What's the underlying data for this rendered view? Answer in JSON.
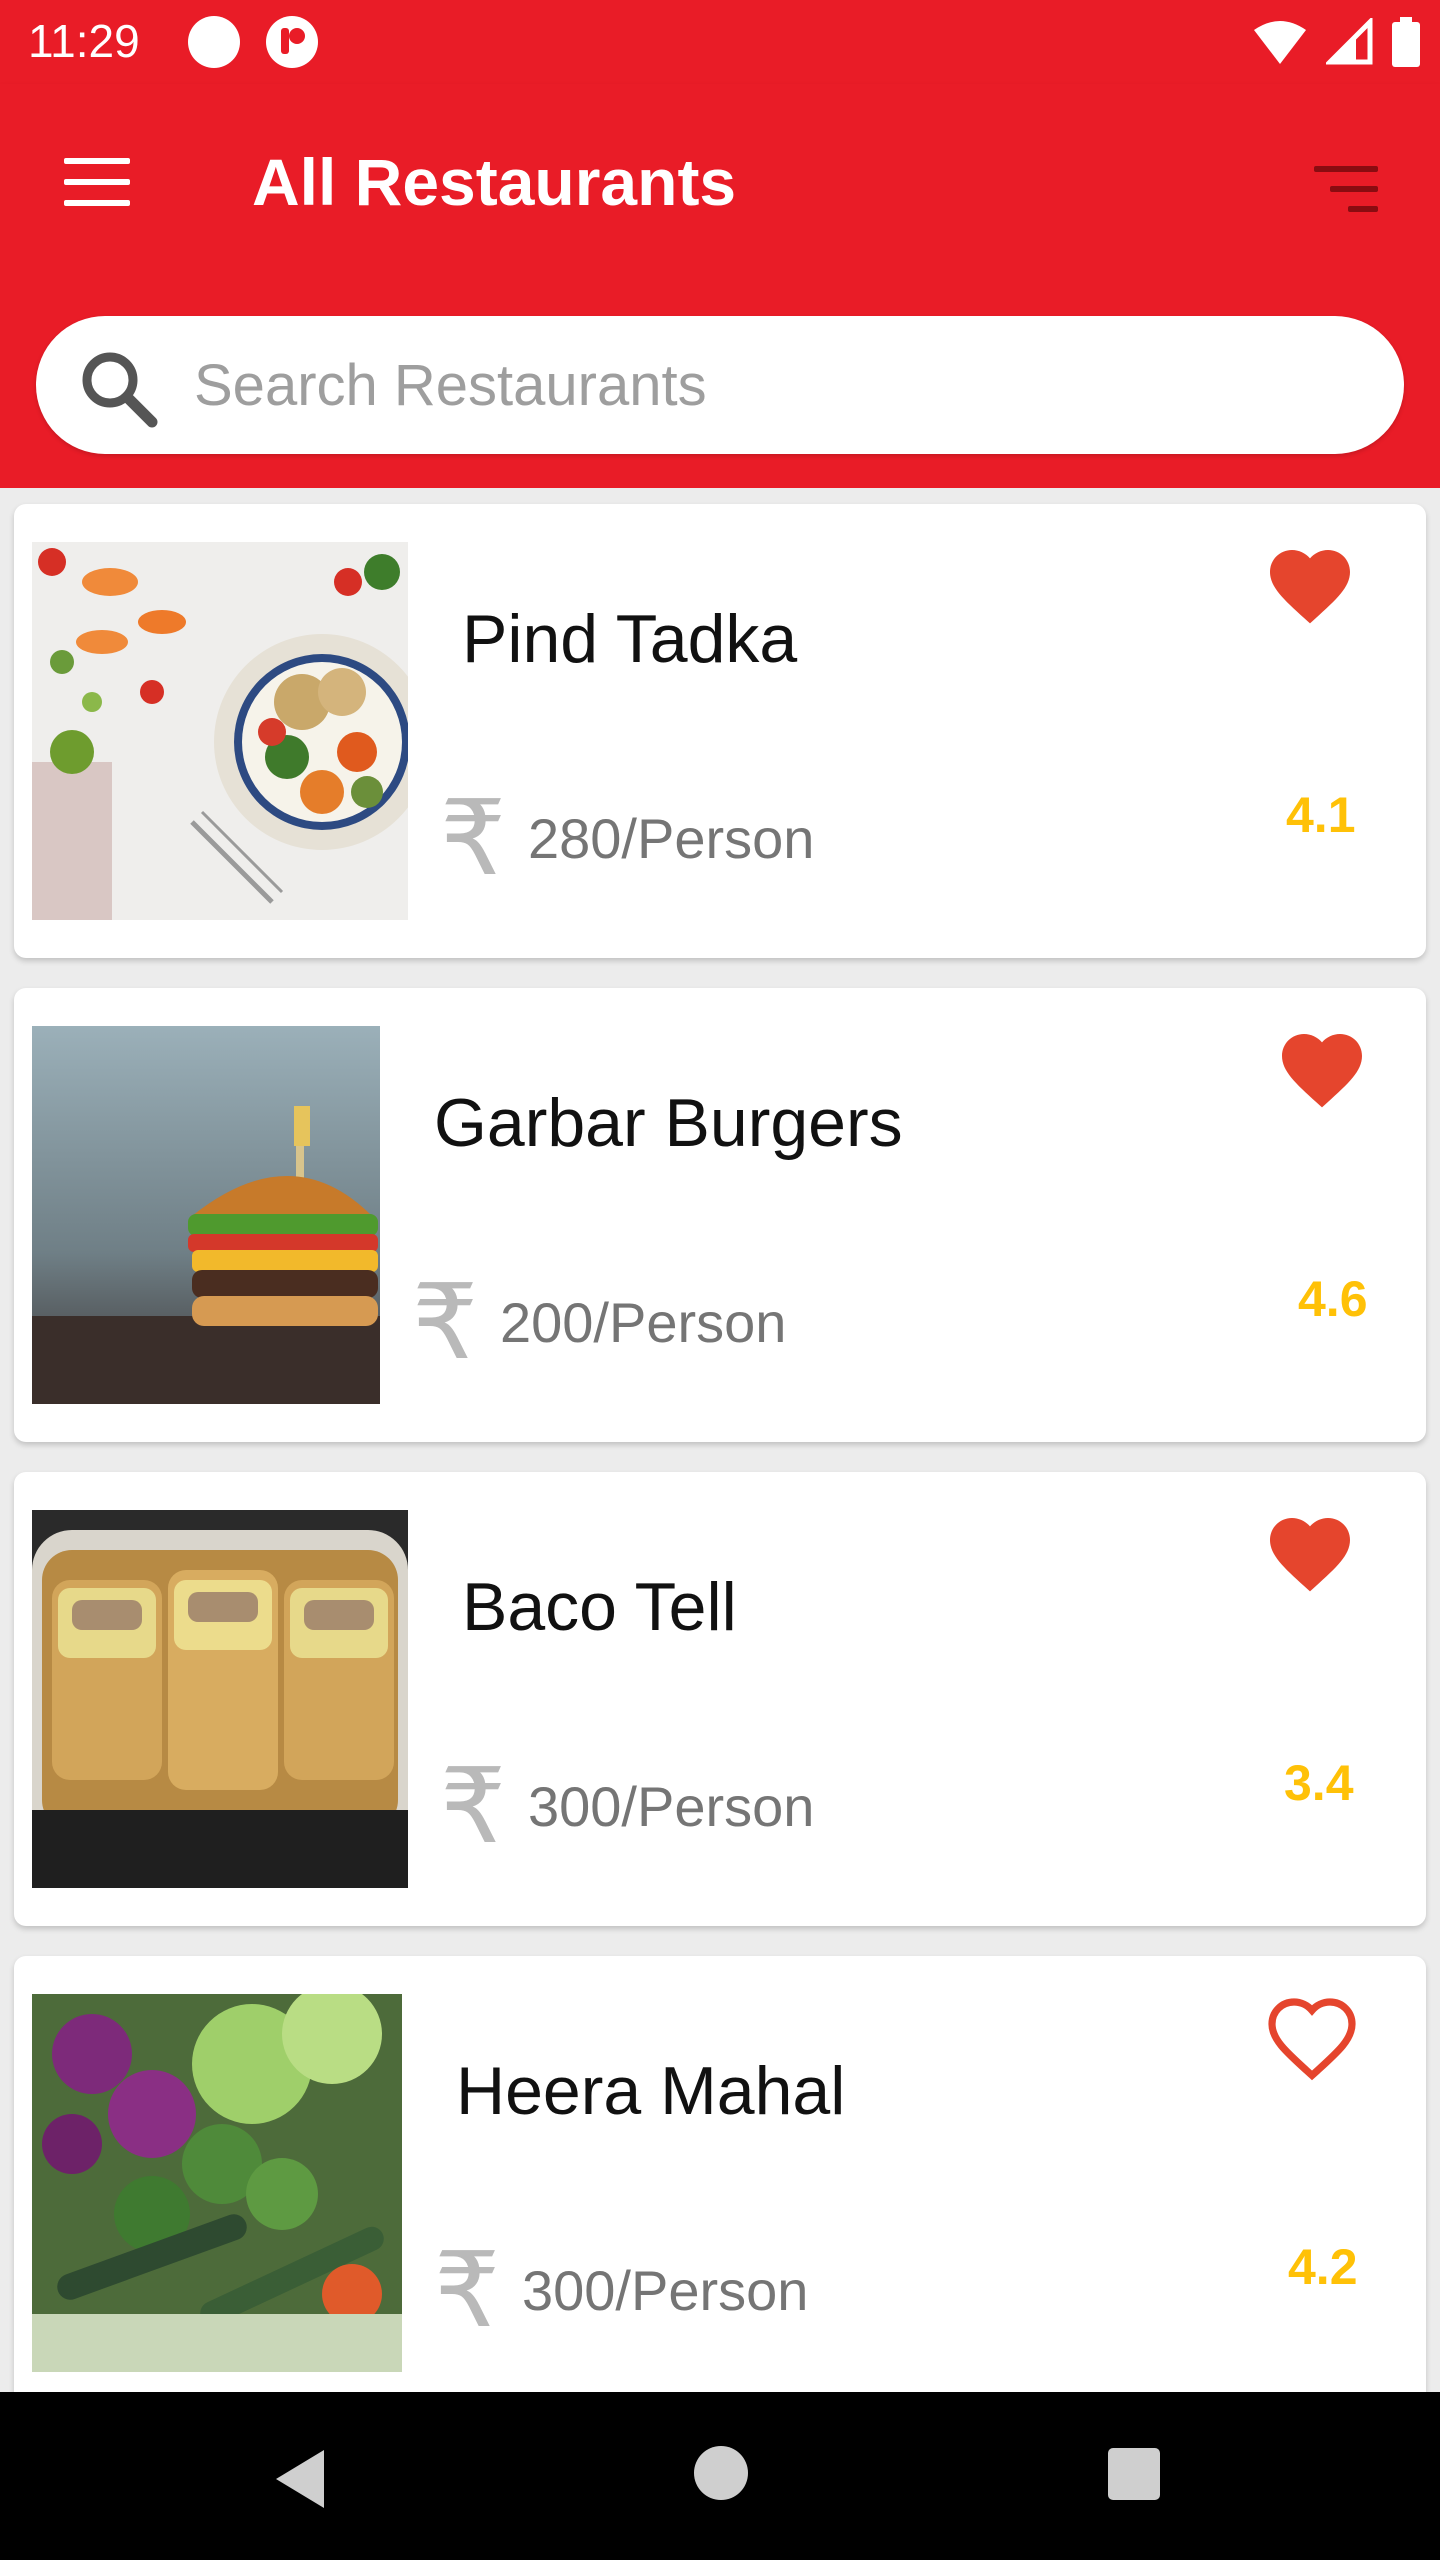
{
  "status_bar": {
    "time": "11:29"
  },
  "app_bar": {
    "title": "All Restaurants",
    "menu_icon": "hamburger-menu-icon",
    "sort_icon": "sort-filter-icon"
  },
  "search": {
    "placeholder": "Search Restaurants",
    "value": ""
  },
  "currency_symbol": "₹",
  "restaurants": [
    {
      "name": "Pind Tadka",
      "price": "280/Person",
      "rating": "4.1",
      "favorite": true
    },
    {
      "name": "Garbar Burgers",
      "price": "200/Person",
      "rating": "4.6",
      "favorite": true
    },
    {
      "name": "Baco Tell",
      "price": "300/Person",
      "rating": "3.4",
      "favorite": true
    },
    {
      "name": "Heera Mahal",
      "price": "300/Person",
      "rating": "4.2",
      "favorite": false
    }
  ],
  "colors": {
    "primary": "#e91c27",
    "heart": "#e5452d",
    "rating": "#ffc107",
    "price": "#757575"
  }
}
